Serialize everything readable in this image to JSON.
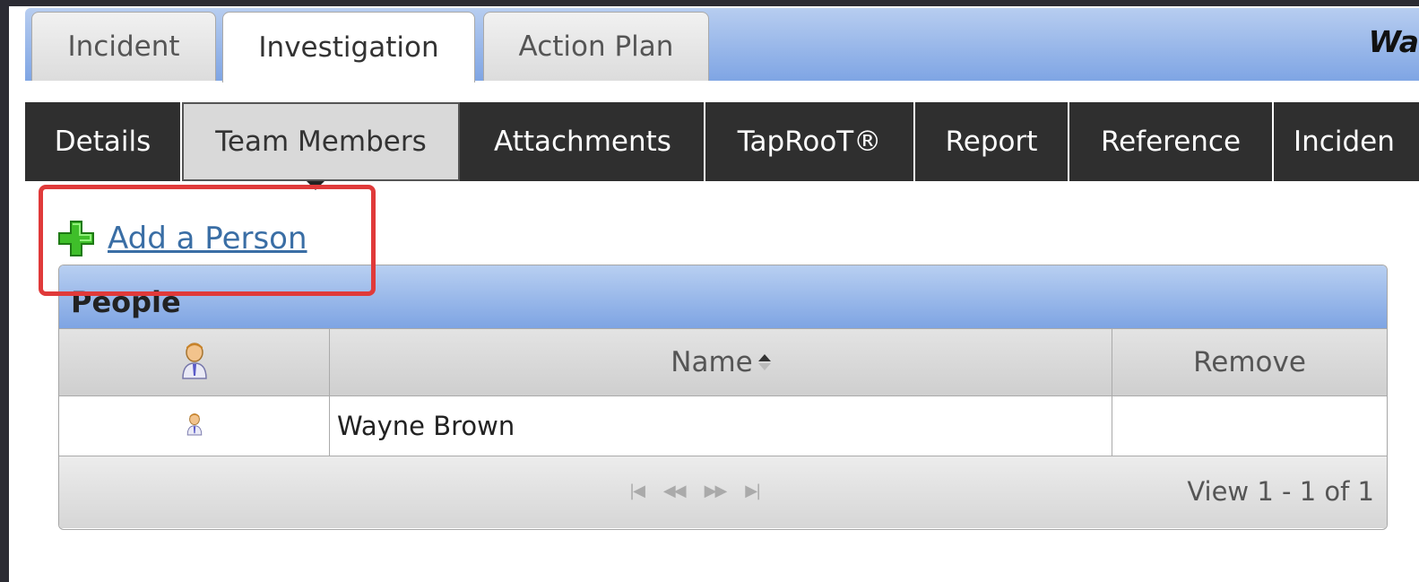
{
  "top_tabs": [
    {
      "label": "Incident",
      "active": false
    },
    {
      "label": "Investigation",
      "active": true
    },
    {
      "label": "Action Plan",
      "active": false
    }
  ],
  "top_title": "Wa",
  "sub_tabs": [
    {
      "label": "Details",
      "active": false
    },
    {
      "label": "Team Members",
      "active": true
    },
    {
      "label": "Attachments",
      "active": false
    },
    {
      "label": "TapRooT®",
      "active": false
    },
    {
      "label": "Report",
      "active": false
    },
    {
      "label": "Reference",
      "active": false
    },
    {
      "label": "Inciden",
      "active": false
    }
  ],
  "add_person": {
    "label": "Add a Person",
    "icon": "plus-icon"
  },
  "grid": {
    "caption": "People",
    "columns": {
      "icon": "person-icon",
      "name": "Name",
      "remove": "Remove"
    },
    "rows": [
      {
        "icon": "person-icon",
        "name": "Wayne Brown",
        "remove": ""
      }
    ],
    "pager": {
      "buttons": [
        "first-page-icon",
        "prev-page-icon",
        "next-page-icon",
        "last-page-icon"
      ],
      "info": "View 1 - 1 of 1"
    }
  },
  "colors": {
    "highlight": "#e03a3a",
    "header_blue": "#7ea4e3",
    "link": "#3a6ea5",
    "subtab_bg": "#2f2f2f"
  }
}
